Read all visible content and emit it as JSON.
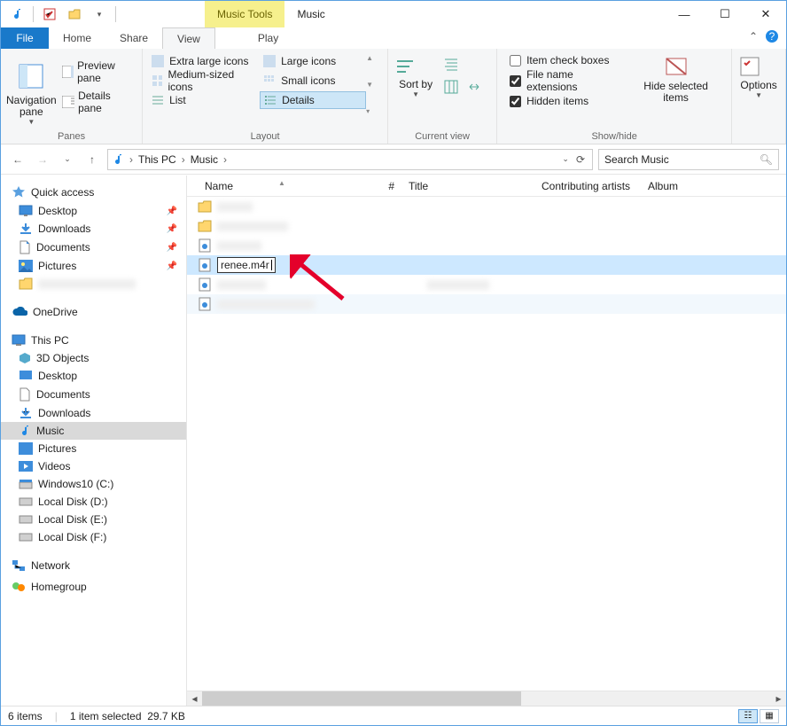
{
  "window": {
    "title": "Music",
    "context_tab": "Music Tools"
  },
  "tabs": {
    "file": "File",
    "home": "Home",
    "share": "Share",
    "view": "View",
    "play": "Play"
  },
  "ribbon": {
    "panes": {
      "nav": "Navigation pane",
      "preview": "Preview pane",
      "details": "Details pane",
      "group": "Panes"
    },
    "layout": {
      "xlarge": "Extra large icons",
      "large": "Large icons",
      "medium": "Medium-sized icons",
      "small": "Small icons",
      "list": "List",
      "details": "Details",
      "group": "Layout"
    },
    "currentview": {
      "sortby": "Sort by",
      "group": "Current view"
    },
    "showhide": {
      "item_check": "Item check boxes",
      "file_ext": "File name extensions",
      "hidden": "Hidden items",
      "hide_sel": "Hide selected items",
      "group": "Show/hide"
    },
    "options": "Options"
  },
  "navbar": {
    "crumbs": [
      "This PC",
      "Music"
    ],
    "search_placeholder": "Search Music"
  },
  "tree": {
    "quick": "Quick access",
    "qa_items": [
      "Desktop",
      "Downloads",
      "Documents",
      "Pictures"
    ],
    "onedrive": "OneDrive",
    "thispc": "This PC",
    "pc_items": [
      "3D Objects",
      "Desktop",
      "Documents",
      "Downloads",
      "Music",
      "Pictures",
      "Videos",
      "Windows10 (C:)",
      "Local Disk (D:)",
      "Local Disk (E:)",
      "Local Disk (F:)"
    ],
    "network": "Network",
    "homegroup": "Homegroup"
  },
  "columns": {
    "name": "Name",
    "num": "#",
    "title": "Title",
    "contrib": "Contributing artists",
    "album": "Album"
  },
  "rename_value": "renee.m4r",
  "status": {
    "count": "6 items",
    "sel": "1 item selected",
    "size": "29.7 KB"
  }
}
